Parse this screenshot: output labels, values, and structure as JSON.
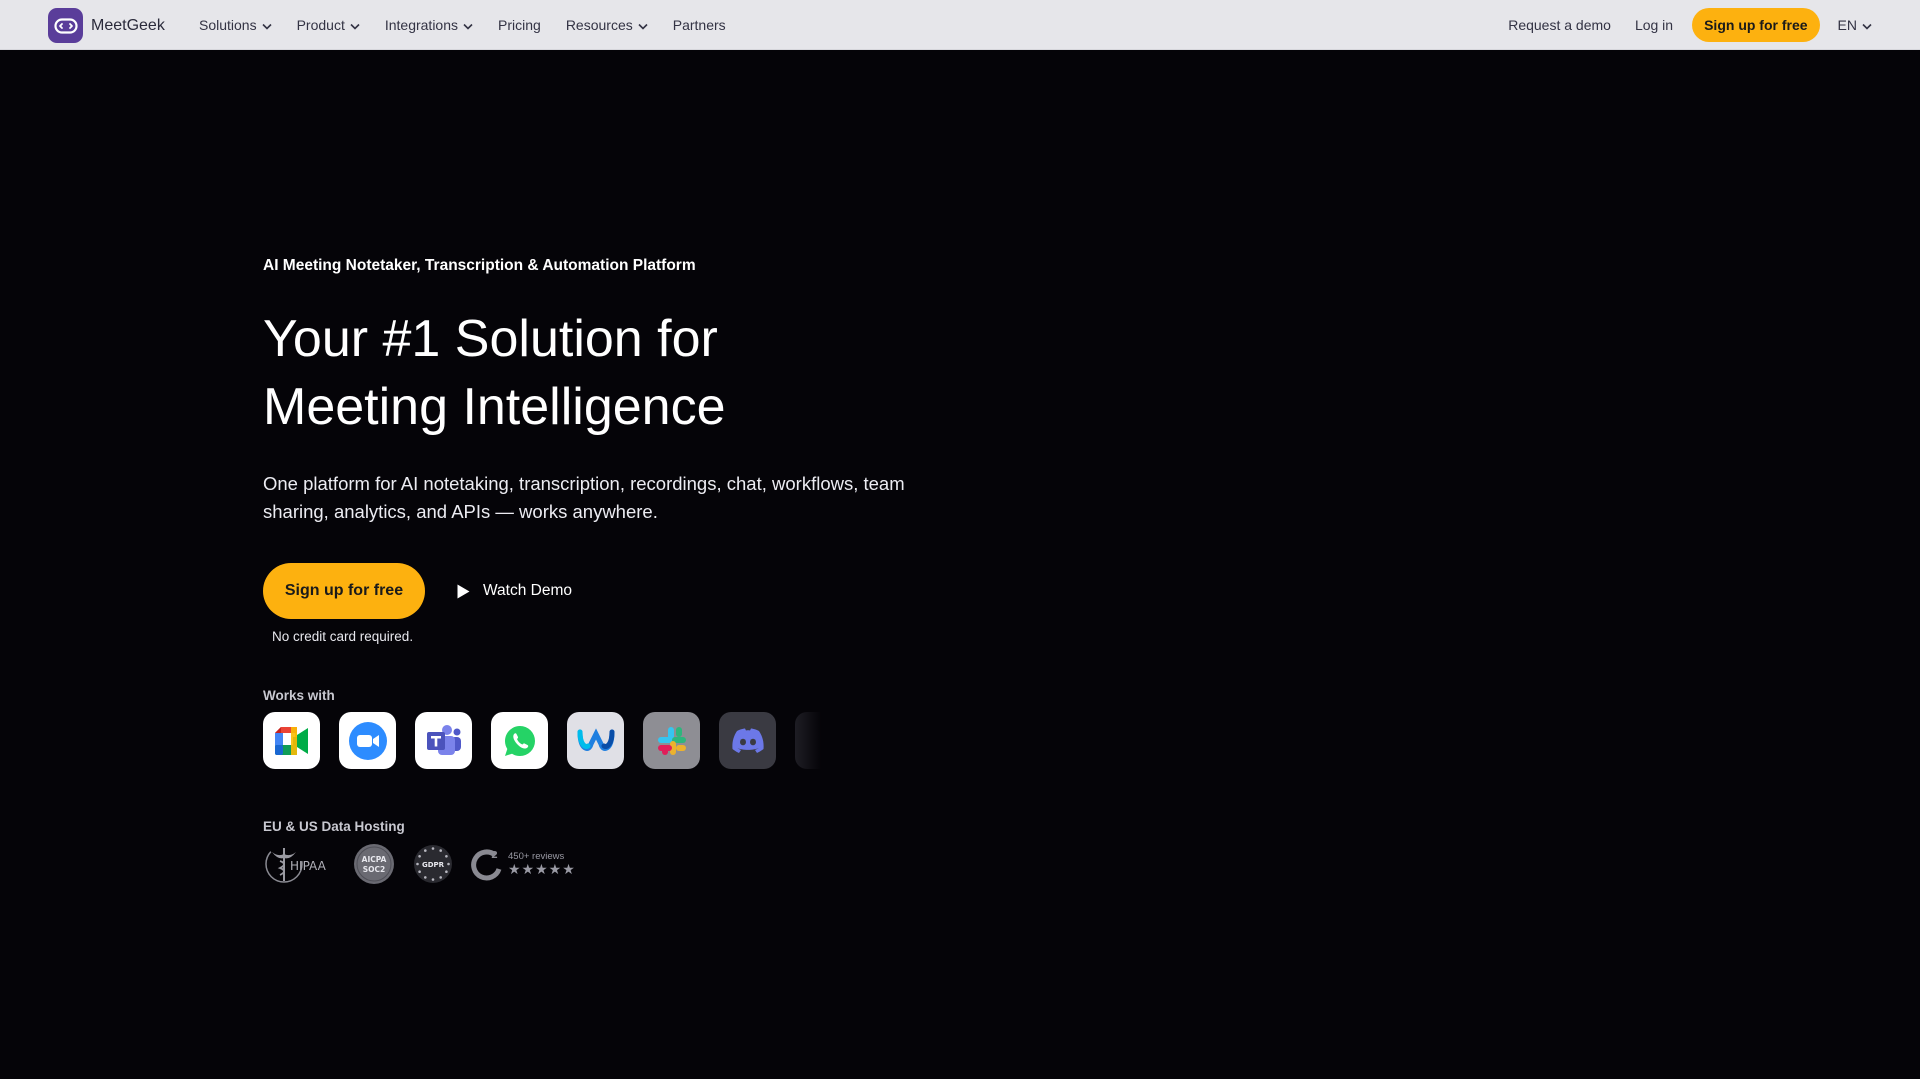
{
  "nav": {
    "brand": "MeetGeek",
    "links": [
      {
        "label": "Solutions",
        "dropdown": true
      },
      {
        "label": "Product",
        "dropdown": true
      },
      {
        "label": "Integrations",
        "dropdown": true
      },
      {
        "label": "Pricing",
        "dropdown": false
      },
      {
        "label": "Resources",
        "dropdown": true
      },
      {
        "label": "Partners",
        "dropdown": false
      }
    ],
    "request_demo": "Request a demo",
    "login": "Log in",
    "signup": "Sign up for free",
    "language": "EN"
  },
  "hero": {
    "eyebrow": "AI Meeting Notetaker, Transcription & Automation Platform",
    "headline_line1": "Your #1 Solution for",
    "headline_line2": "Meeting Intelligence",
    "subtitle": "One platform for AI notetaking, transcription, recordings, chat, workflows, team sharing, analytics, and APIs — works anywhere.",
    "cta_primary": "Sign up for free",
    "cta_secondary": "Watch Demo",
    "no_card_note": "No credit card required."
  },
  "works_with": {
    "label": "Works with",
    "apps": [
      "google-meet-icon",
      "zoom-icon",
      "microsoft-teams-icon",
      "whatsapp-icon",
      "webex-icon",
      "slack-icon",
      "discord-icon"
    ]
  },
  "hosting": {
    "label": "EU & US Data Hosting",
    "badges": [
      "HIPAA",
      "AICPA SOC2",
      "GDPR"
    ],
    "g2_reviews": "450+ reviews",
    "g2_stars": "★★★★★",
    "g2_rating": 5
  },
  "colors": {
    "accent": "#fdb10f",
    "brand": "#5a3d9a",
    "hero_bg": "#050408",
    "nav_bg": "#e6e6ea"
  }
}
